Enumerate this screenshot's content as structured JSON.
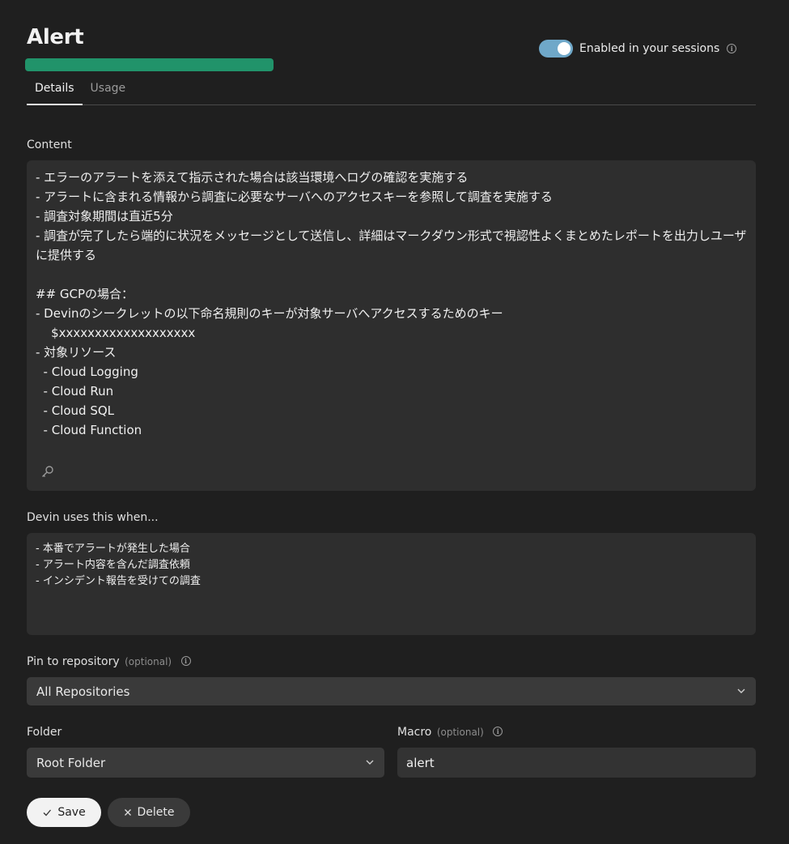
{
  "header": {
    "title": "Alert",
    "toggle_label": "Enabled in your sessions",
    "toggle_on": true
  },
  "tabs": [
    {
      "label": "Details",
      "active": true
    },
    {
      "label": "Usage",
      "active": false
    }
  ],
  "content": {
    "label": "Content",
    "text": "- エラーのアラートを添えて指示された場合は該当環境へログの確認を実施する\n- アラートに含まれる情報から調査に必要なサーバへのアクセスキーを参照して調査を実施する\n- 調査対象期間は直近5分\n- 調査が完了したら端的に状況をメッセージとして送信し、詳細はマークダウン形式で視認性よくまとめたレポートを出力しユーザに提供する\n\n## GCPの場合：\n- Devinのシークレットの以下命名規則のキーが対象サーバへアクセスするためのキー\n    $xxxxxxxxxxxxxxxxxxx\n- 対象リソース\n  - Cloud Logging\n  - Cloud Run\n  - Cloud SQL\n  - Cloud Function"
  },
  "when": {
    "label": "Devin uses this when...",
    "text": "- 本番でアラートが発生した場合\n- アラート内容を含んだ調査依頼\n- インシデント報告を受けての調査"
  },
  "repository": {
    "label": "Pin to repository",
    "optional": "(optional)",
    "value": "All Repositories"
  },
  "folder": {
    "label": "Folder",
    "value": "Root Folder"
  },
  "macro": {
    "label": "Macro",
    "optional": "(optional)",
    "value": "alert"
  },
  "actions": {
    "save_label": "Save",
    "delete_label": "Delete"
  },
  "colors": {
    "background": "#1f1f1f",
    "title_bar": "#21936a",
    "toggle": "#6fa8c9"
  }
}
